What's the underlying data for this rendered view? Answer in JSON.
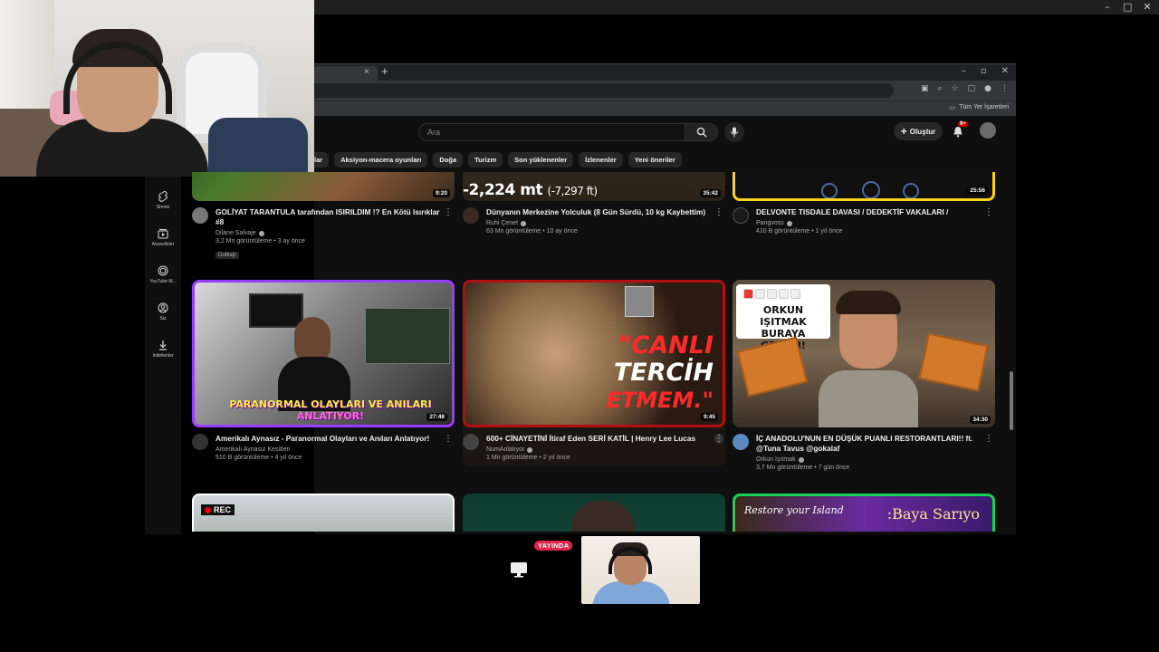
{
  "os": {
    "controls": [
      "–",
      "□",
      "✕"
    ]
  },
  "browser": {
    "tab_close": "×",
    "new_tab": "+",
    "window_controls": [
      "–",
      "▫",
      "✕"
    ],
    "bookmarks_all": "Tüm Yer İşaretleri"
  },
  "yt": {
    "search_placeholder": "Ara",
    "create_label": "Oluştur",
    "notif_count": "9+",
    "chips": [
      "lar",
      "Aksiyon-macera oyunları",
      "Doğa",
      "Turizm",
      "Son yüklenenler",
      "İzlenenler",
      "Yeni öneriler"
    ],
    "nav": [
      {
        "icon": "shorts-icon",
        "label": "Shorts"
      },
      {
        "icon": "subscriptions-icon",
        "label": "Abonelikler"
      },
      {
        "icon": "youtube-music-icon",
        "label": "YouTube M..."
      },
      {
        "icon": "you-icon",
        "label": "Siz"
      },
      {
        "icon": "downloads-icon",
        "label": "İndirilenler"
      }
    ]
  },
  "videos": {
    "row1": [
      {
        "title": "GOLİYAT TARANTULA tarafından ISIRILDIM !? En Kötü Isırıklar #8",
        "channel": "Dilane Salvaje",
        "stats": "3,2 Mn görüntüleme • 3 ay önce",
        "duration": "9:20",
        "badge": "Dublajlı",
        "color": "#888"
      },
      {
        "title": "Dünyanın Merkezine Yolculuk (8 Gün Sürdü, 10 kg Kaybettim)",
        "channel": "Ruhi Çenet",
        "stats": "63 Mn görüntüleme • 10 ay önce",
        "duration": "35:42",
        "overlay": "-2,224 mt",
        "overlay_small": "(-7,297 ft)",
        "color": "#3a2a22"
      },
      {
        "title": "DELVONTE TISDALE DAVASI / DEDEKTİF VAKALARI /",
        "channel": "Pangvoss",
        "stats": "410 B görüntüleme • 1 yıl önce",
        "duration": "25:56",
        "color": "#1a1a1a"
      }
    ],
    "row2": [
      {
        "title": "Amerikalı Aynasız - Paranormal Olayları ve Anıları Anlatıyor!",
        "channel": "Amerikalı Aynasız Kesitleri",
        "stats": "510 B görüntüleme • 4 yıl önce",
        "duration": "27:48",
        "overlay1": "PARANORMAL OLAYLARI VE ANILARI",
        "overlay2": "ANLATIYOR!",
        "color": "#2a2a2a"
      },
      {
        "title": "600+ CİNAYETİNİ İtiraf Eden SERİ KATİL | Henry Lee Lucas",
        "channel": "NumAnlatıyor",
        "stats": "1 Mn görüntüleme • 2 yıl önce",
        "duration": "9:45",
        "w1": "\"CANLI",
        "w2": "TERCİH",
        "w3": "ETMEM.\"",
        "color": "#444"
      },
      {
        "title": "İÇ ANADOLU'NUN EN DÜŞÜK PUANLI RESTORANTLARI!! ft. @Tuna Tavus @gokalaf",
        "channel": "Orkun Işıtmak",
        "stats": "3,7 Mn görüntüleme • 7 gün önce",
        "duration": "34:30",
        "sign": "ORKUN IŞITMAK BURAYA GELSİN!",
        "color": "#5a8ac0"
      }
    ],
    "row3": [
      {
        "badge": "REC"
      },
      {},
      {
        "overlay": ":Baya Sarıyo",
        "restore": "Restore your Island"
      }
    ]
  },
  "call": {
    "live_label": "YAYINDA"
  }
}
